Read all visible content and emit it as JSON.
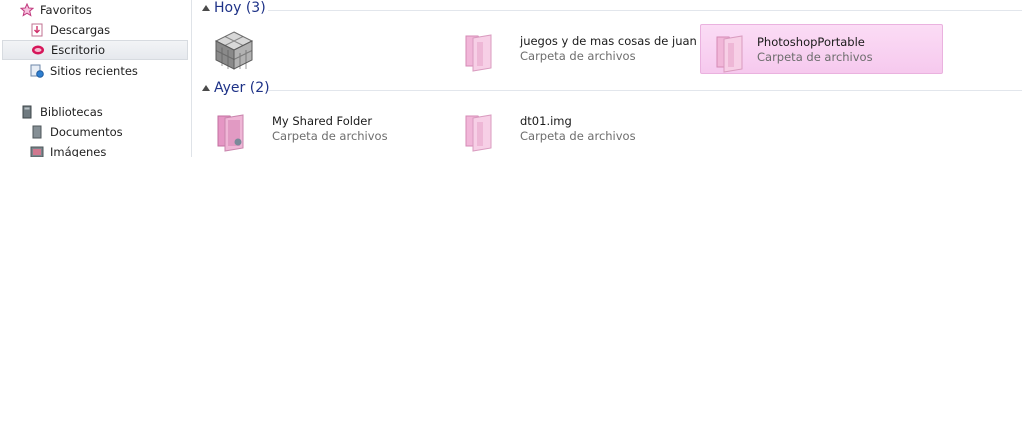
{
  "sidebar": {
    "favorites": {
      "label": "Favoritos",
      "icon": "star-icon"
    },
    "favorite_items": [
      {
        "label": "Descargas",
        "icon": "downloads-icon",
        "selected": false
      },
      {
        "label": "Escritorio",
        "icon": "desktop-icon",
        "selected": true
      },
      {
        "label": "Sitios recientes",
        "icon": "recent-places-icon",
        "selected": false
      }
    ],
    "libraries": {
      "label": "Bibliotecas",
      "icon": "libraries-icon"
    },
    "library_items": [
      {
        "label": "Documentos",
        "icon": "documents-icon"
      },
      {
        "label": "Imágenes",
        "icon": "pictures-icon"
      }
    ]
  },
  "groups": [
    {
      "title": "Hoy (3)",
      "items": [
        {
          "name": "",
          "type": "",
          "icon": "cube-app-icon",
          "selected": false
        },
        {
          "name": "juegos y de mas cosas de juan",
          "type": "Carpeta de archivos",
          "icon": "folder-icon",
          "selected": false
        },
        {
          "name": "PhotoshopPortable",
          "type": "Carpeta de archivos",
          "icon": "folder-icon",
          "selected": true
        }
      ]
    },
    {
      "title": "Ayer (2)",
      "items": [
        {
          "name": "My Shared Folder",
          "type": "Carpeta de archivos",
          "icon": "shared-folder-icon",
          "selected": false
        },
        {
          "name": "dt01.img",
          "type": "Carpeta de archivos",
          "icon": "folder-icon",
          "selected": false
        }
      ]
    }
  ],
  "colors": {
    "accent_pink": "#f6c9ee",
    "group_title": "#1e3287"
  }
}
